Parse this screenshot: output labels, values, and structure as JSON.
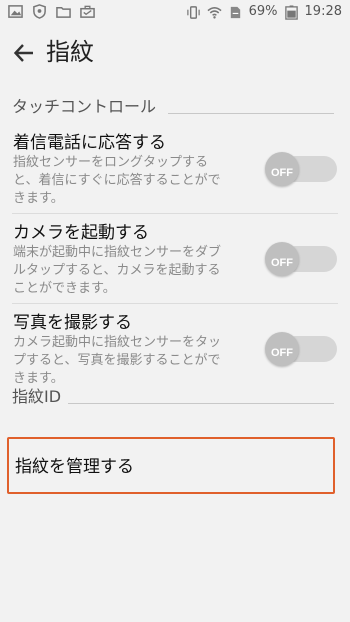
{
  "status_bar": {
    "battery": "69%",
    "time": "19:28",
    "left_icons": [
      "image-icon",
      "shield-icon",
      "folder-icon",
      "briefcase-icon"
    ],
    "right_icons": [
      "vibrate-icon",
      "wifi-icon",
      "sim-icon",
      "battery-icon"
    ]
  },
  "app_bar": {
    "title": "指紋"
  },
  "sections": [
    {
      "header": "タッチコントロール"
    },
    {
      "header": "指紋ID"
    }
  ],
  "settings": [
    {
      "title": "着信電話に応答する",
      "desc_lines": [
        "指紋センサーをロングタップする",
        "と、着信にすぐに応答することがで",
        "きます。"
      ],
      "toggle": "OFF"
    },
    {
      "title": "カメラを起動する",
      "desc_lines": [
        "端末が起動中に指紋センサーをダブ",
        "ルタップすると、カメラを起動する",
        "ことができます。"
      ],
      "toggle": "OFF"
    },
    {
      "title": "写真を撮影する",
      "desc_lines": [
        "カメラ起動中に指紋センサーをタッ",
        "プすると、写真を撮影することがで",
        "きます。"
      ],
      "toggle": "OFF"
    }
  ],
  "manage_fingerprints": {
    "label": "指紋を管理する"
  },
  "colors": {
    "highlight_border": "#e0602c",
    "toggle_off": "#bfbfbf"
  }
}
